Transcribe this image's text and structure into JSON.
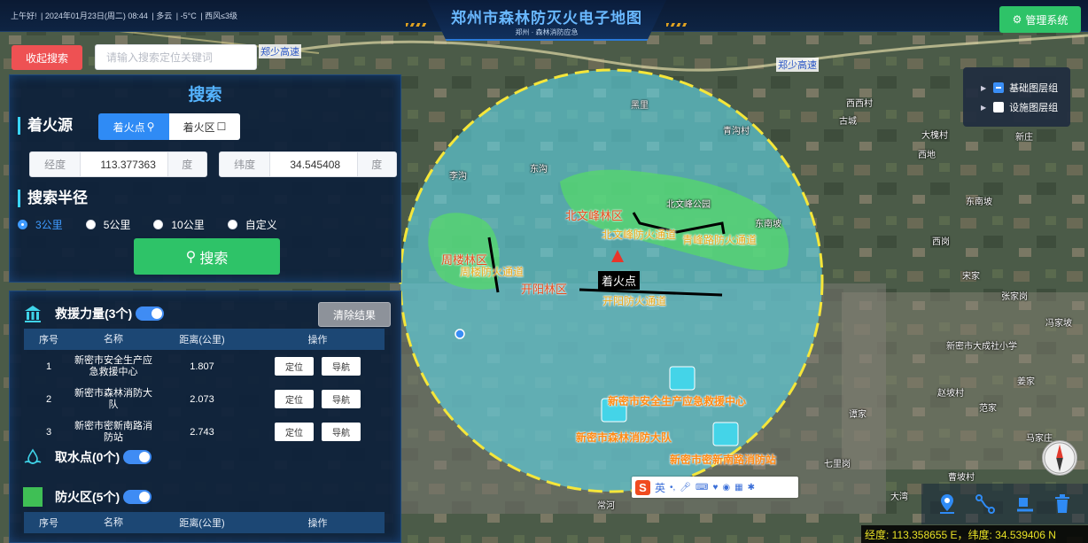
{
  "header": {
    "weather": [
      "上午好!",
      "2024年01月23日(周二) 08:44",
      "多云",
      "-5°C",
      "西风≤3级"
    ],
    "title": "郑州市森林防灭火电子地图",
    "subtitle": "郑州 · 森林消防应急",
    "admin_label": "管理系统"
  },
  "search_bar": {
    "collapse_label": "收起搜索",
    "placeholder": "请输入搜索定位关键词"
  },
  "search_panel": {
    "heading": "搜索",
    "fire_source_title": "着火源",
    "tabs": [
      "着火点",
      "着火区"
    ],
    "active_tab": "着火点",
    "longitude_label": "经度",
    "longitude_value": "113.377363",
    "longitude_unit": "度",
    "latitude_label": "纬度",
    "latitude_value": "34.545408",
    "latitude_unit": "度",
    "radius_title": "搜索半径",
    "radius_options": [
      "3公里",
      "5公里",
      "10公里",
      "自定义"
    ],
    "radius_selected": "3公里",
    "search_button": "搜索"
  },
  "results": {
    "clear_label": "清除结果",
    "rescue": {
      "label": "救援力量(3个)",
      "columns": [
        "序号",
        "名称",
        "距离(公里)",
        "操作"
      ],
      "rows": [
        {
          "idx": "1",
          "name": "新密市安全生产应急救援中心",
          "dist": "1.807"
        },
        {
          "idx": "2",
          "name": "新密市森林消防大队",
          "dist": "2.073"
        },
        {
          "idx": "3",
          "name": "新密市密新南路消防站",
          "dist": "2.743"
        }
      ],
      "op_locate": "定位",
      "op_navigate": "导航"
    },
    "water": {
      "label": "取水点(0个)"
    },
    "firebreak": {
      "label": "防火区(5个)",
      "columns": [
        "序号",
        "名称",
        "距离(公里)",
        "操作"
      ]
    }
  },
  "layers": {
    "items": [
      "基础图层组",
      "设施图层组"
    ]
  },
  "map": {
    "fire_point_label": "着火点",
    "zones": [
      "北文峰林区",
      "周楼林区",
      "开阳林区"
    ],
    "fire_paths": [
      "北文峰防火通道",
      "青峰路防火通道",
      "周楼防火通道",
      "开阳防火通道"
    ],
    "stations": [
      "新密市安全生产应急救援中心",
      "新密市森林消防大队",
      "新密市密新南路消防站"
    ],
    "roads": [
      "郑少高速",
      "郑少高速"
    ],
    "place_names": [
      "黑里",
      "北文峰公园",
      "青沟村",
      "李沟",
      "东沟",
      "大槐村",
      "古城",
      "西西村",
      "新庄",
      "西地",
      "东南坡",
      "东南坡",
      "西岗",
      "宋家",
      "张家岗",
      "新密市大成社小学",
      "赵坡村",
      "姜家",
      "马家庄",
      "七里岗",
      "大湾",
      "常河",
      "曹坡村",
      "范家",
      "谭家",
      "冯家坡"
    ],
    "ime_label": "英",
    "coord_text": "经度: 113.358655 E，纬度:  34.539406 N"
  },
  "colors": {
    "accent_blue": "#2f8bf5",
    "green": "#2ec368",
    "red": "#ee5153",
    "circle_fill": "#5fd6e6",
    "circle_border": "#f5e63a",
    "forest_zone": "#55d86a"
  }
}
